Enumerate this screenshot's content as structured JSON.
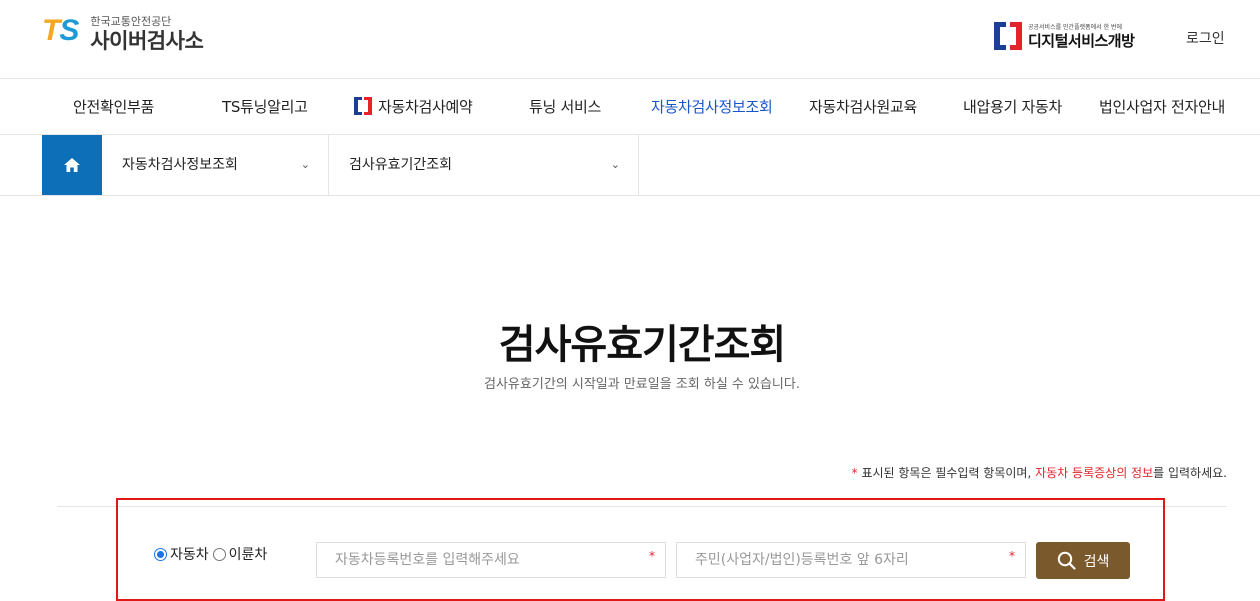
{
  "header": {
    "logo_mark_t": "T",
    "logo_mark_s": "S",
    "org_name": "한국교통안전공단",
    "site_name": "사이버검사소",
    "digital_sub": "공공서비스를 민간플랫폼에서 한 번에",
    "digital_main": "디지털서비스개방",
    "login": "로그인"
  },
  "gnb": {
    "items": [
      {
        "label": "안전확인부품"
      },
      {
        "label": "TS튜닝알리고"
      },
      {
        "label": "자동차검사예약"
      },
      {
        "label": "튜닝 서비스"
      },
      {
        "label": "자동차검사정보조회"
      },
      {
        "label": "자동차검사원교육"
      },
      {
        "label": "내압용기 자동차"
      },
      {
        "label": "법인사업자 전자안내"
      }
    ],
    "active_index": 4
  },
  "breadcrumb": {
    "level1": "자동차검사정보조회",
    "level2": "검사유효기간조회"
  },
  "content": {
    "title": "검사유효기간조회",
    "description": "검사유효기간의 시작일과 만료일을 조회 하실 수 있습니다.",
    "required_note": {
      "star": "*",
      "text1": " 표시된 항목은 필수입력 항목이며, ",
      "highlight": "자동차 등록증상의 정보",
      "text2": "를 입력하세요."
    }
  },
  "form": {
    "vehicle_types": [
      {
        "label": "자동차",
        "checked": true
      },
      {
        "label": "이륜차",
        "checked": false
      }
    ],
    "reg_number_placeholder": "자동차등록번호를 입력해주세요",
    "id_number_placeholder": "주민(사업자/법인)등록번호 앞 6자리",
    "required_mark": "*",
    "search_label": "검색"
  },
  "colors": {
    "accent_blue": "#0d6fb8",
    "active_nav": "#1a56c7",
    "search_button": "#7a5a2c",
    "required_red": "#e3242b"
  }
}
